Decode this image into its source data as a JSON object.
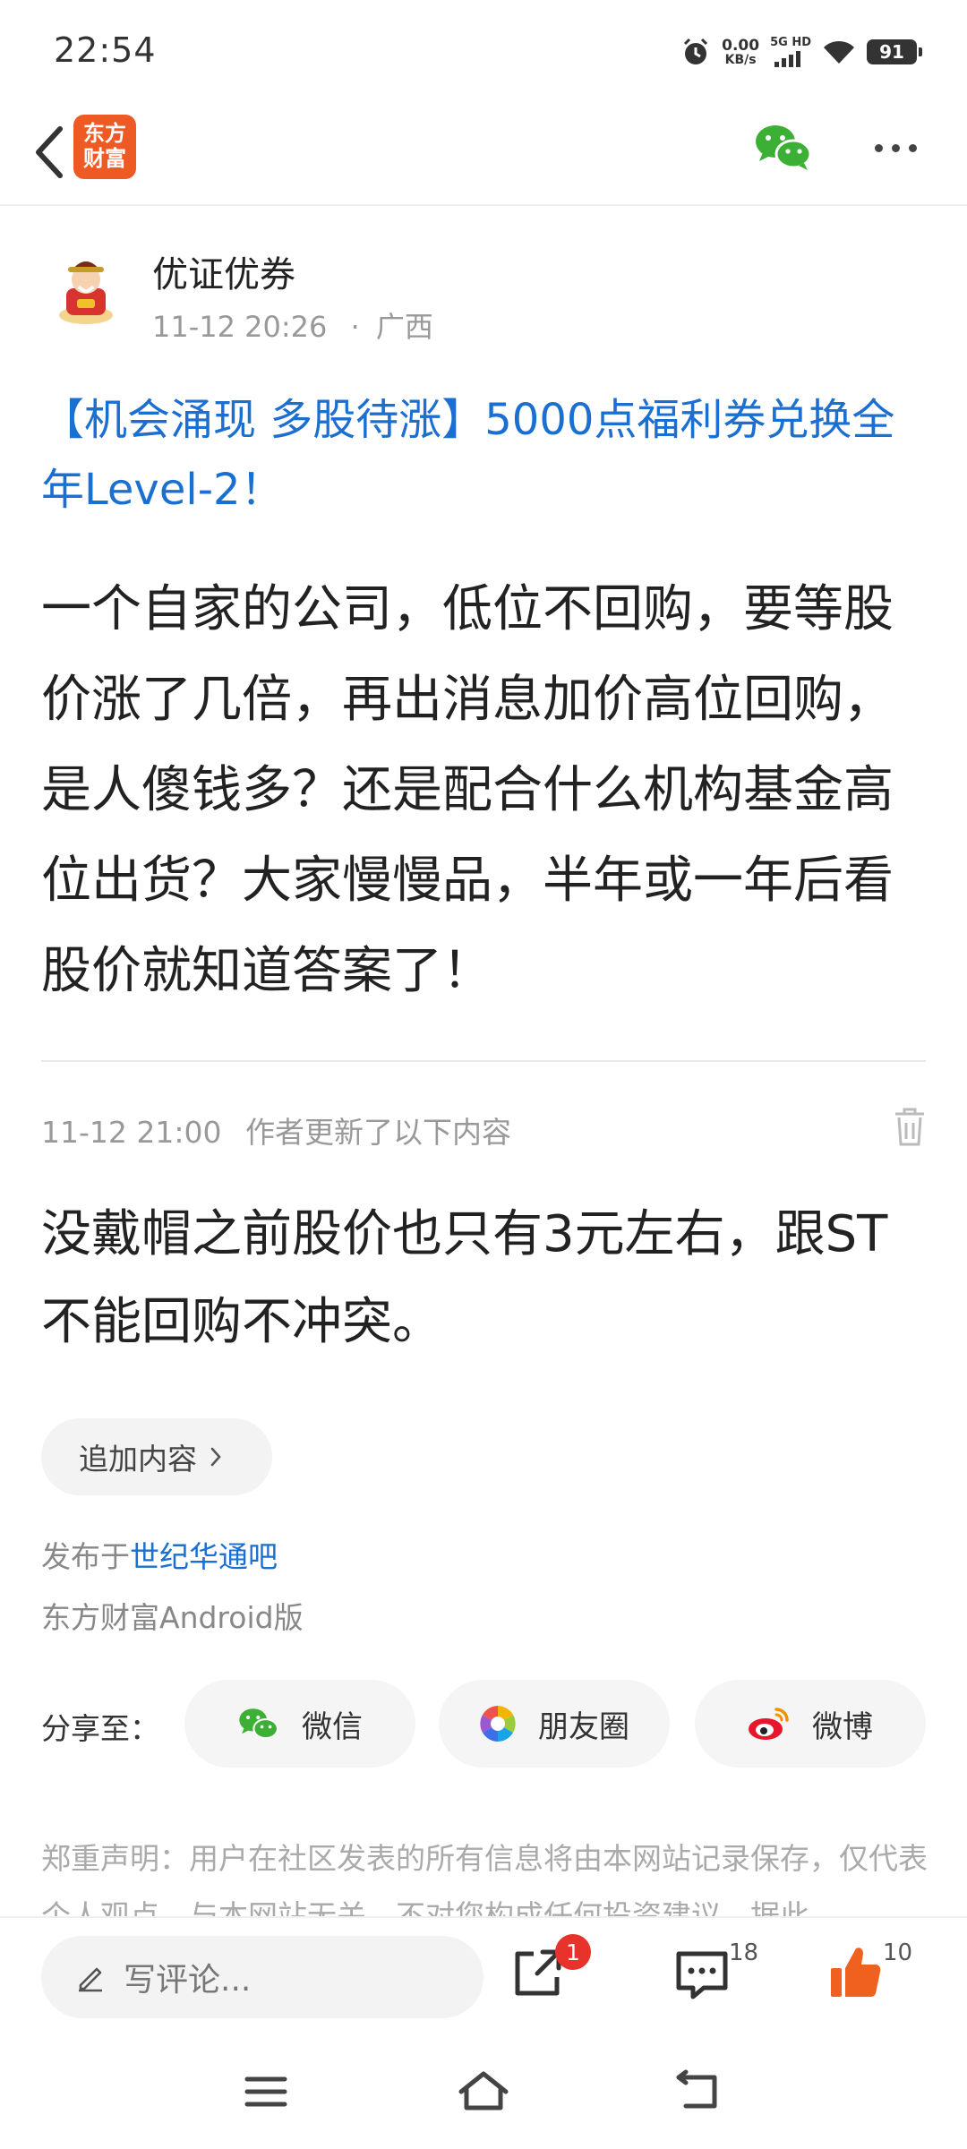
{
  "status_bar": {
    "time": "22:54",
    "net_speed_value": "0.00",
    "net_speed_unit": "KB/s",
    "network": "5G HD",
    "battery": "91",
    "icons": [
      "alarm-icon",
      "signal-icon",
      "wifi-icon",
      "battery-icon"
    ]
  },
  "nav": {
    "logo_line1": "东方",
    "logo_line2": "财富",
    "icons": [
      "back-icon",
      "wechat-icon",
      "more-icon"
    ]
  },
  "author": {
    "name": "优证优券",
    "time": "11-12 20:26",
    "separator": "·",
    "location": "广西"
  },
  "post": {
    "title": "【机会涌现 多股待涨】5000点福利券兑换全年Level-2！",
    "body": "一个自家的公司，低位不回购，要等股价涨了几倍，再出消息加价高位回购，是人傻钱多？还是配合什么机构基金高位出货？大家慢慢品，半年或一年后看股价就知道答案了！"
  },
  "update": {
    "time": "11-12 21:00",
    "label": "作者更新了以下内容",
    "body": "没戴帽之前股价也只有3元左右，跟ST不能回购不冲突。"
  },
  "add_content": {
    "label": "追加内容"
  },
  "publish": {
    "prefix": "发布于",
    "forum": "世纪华通吧",
    "client": "东方财富Android版"
  },
  "share": {
    "label": "分享至：",
    "targets": [
      {
        "label": "微信",
        "icon": "wechat-icon"
      },
      {
        "label": "朋友圈",
        "icon": "moments-icon"
      },
      {
        "label": "微博",
        "icon": "weibo-icon"
      }
    ]
  },
  "disclaimer": "郑重声明：用户在社区发表的所有信息将由本网站记录保存，仅代表个人观点，与本网站无关，不对您构成任何投资建议，据此",
  "bottom": {
    "comment_placeholder": "写评论...",
    "share_badge": "1",
    "comment_count": "18",
    "like_count": "10",
    "like_color": "#f0601e"
  },
  "colors": {
    "link": "#1b6fd1",
    "brand": "#ee5a24",
    "badge": "#e8332c"
  }
}
